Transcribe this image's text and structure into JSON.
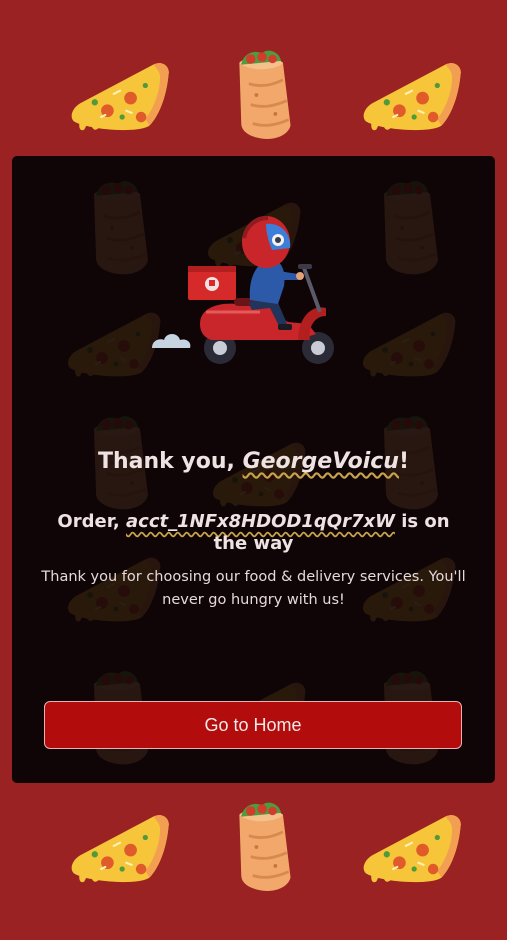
{
  "thank_you": {
    "prefix": "Thank you, ",
    "username": "GeorgeVoicu",
    "suffix": "!"
  },
  "order": {
    "prefix": "Order, ",
    "id": "acct_1NFx8HDOD1qQr7xW",
    "suffix": " is on the way"
  },
  "message": "Thank you for choosing our food & delivery services. You'll never go hungry with us!",
  "home_button": {
    "label": "Go to Home"
  },
  "colors": {
    "page_background": "#9b2222",
    "card_background": "#0f0406",
    "button_background": "#b20c0c",
    "text": "#efe2e2"
  },
  "icons": [
    "pizza-slice-icon",
    "burrito-icon",
    "delivery-scooter-illustration"
  ]
}
